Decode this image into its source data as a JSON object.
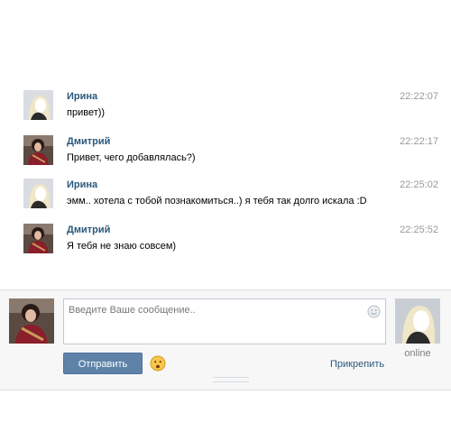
{
  "messages": [
    {
      "author": "Ирина",
      "time": "22:22:07",
      "text": "привет))"
    },
    {
      "author": "Дмитрий",
      "time": "22:22:17",
      "text": "Привет, чего добавлялась?)"
    },
    {
      "author": "Ирина",
      "time": "22:25:02",
      "text": "эмм.. хотела с тобой познакомиться..) я тебя так долго искала :D"
    },
    {
      "author": "Дмитрий",
      "time": "22:25:52",
      "text": "Я тебя не знаю совсем)"
    }
  ],
  "composer": {
    "placeholder": "Введите Ваше сообщение..",
    "send_label": "Отправить",
    "attach_label": "Прикрепить",
    "peer_status": "online"
  },
  "colors": {
    "link": "#2b587a",
    "button": "#5e82a8",
    "time": "#999999"
  },
  "icons": {
    "emoji_picker": "smile-icon",
    "reaction": "sad-face-icon"
  }
}
